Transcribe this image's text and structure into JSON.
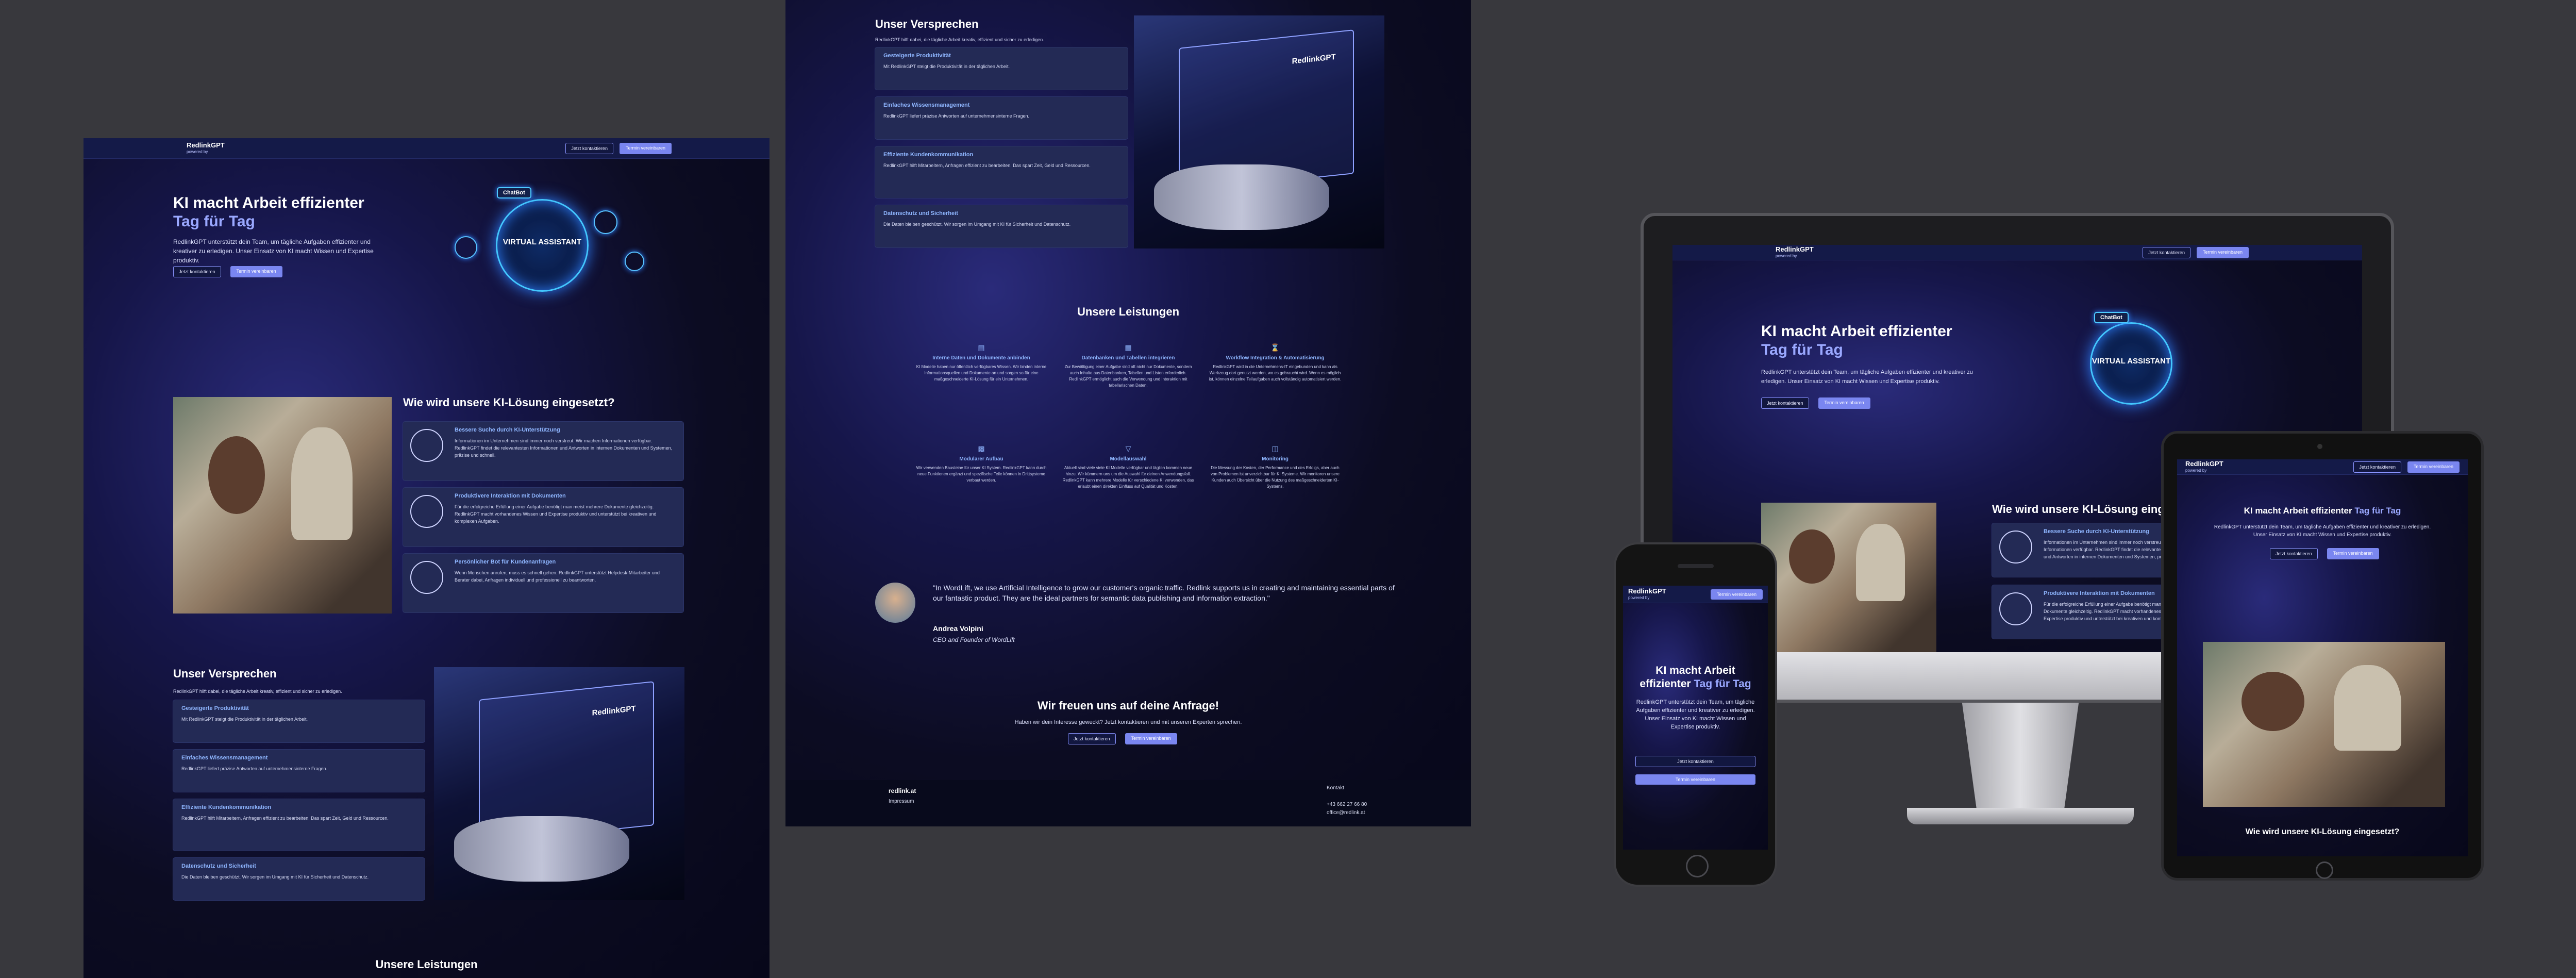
{
  "brand": {
    "name": "RedlinkGPT",
    "powered": "powered by"
  },
  "nav": {
    "contact": "Jetzt kontaktieren",
    "book": "Termin vereinbaren"
  },
  "hero": {
    "title_line1": "KI macht Arbeit effizienter",
    "title_accent": "Tag für Tag",
    "text": "RedlinkGPT unterstützt dein Team, um tägliche Aufgaben effizienter und kreativer zu erledigen. Unser Einsatz von KI macht Wissen und Expertise produktiv.",
    "btn_contact": "Jetzt kontaktieren",
    "btn_book": "Termin vereinbaren",
    "chatbot": "ChatBot",
    "assistant": "VIRTUAL ASSISTANT"
  },
  "usage": {
    "title": "Wie wird unsere KI-Lösung eingesetzt?",
    "items": [
      {
        "title": "Bessere Suche durch KI-Unterstützung",
        "text": "Informationen im Unternehmen sind immer noch verstreut. Wir machen Informationen verfügbar. RedlinkGPT findet die relevantesten Informationen und Antworten in internen Dokumenten und Systemen, präzise und schnell."
      },
      {
        "title": "Produktivere Interaktion mit Dokumenten",
        "text": "Für die erfolgreiche Erfüllung einer Aufgabe benötigt man meist mehrere Dokumente gleichzeitig. RedlinkGPT macht vorhandenes Wissen und Expertise produktiv und unterstützt bei kreativen und komplexen Aufgaben."
      },
      {
        "title": "Persönlicher Bot für Kundenanfragen",
        "text": "Wenn Menschen anrufen, muss es schnell gehen. RedlinkGPT unterstützt Helpdesk-Mitarbeiter und Berater dabei, Anfragen individuell und professionell zu beantworten."
      }
    ]
  },
  "promise": {
    "title": "Unser Versprechen",
    "subtitle": "RedlinkGPT hilft dabei, die tägliche Arbeit kreativ, effizient und sicher zu erledigen.",
    "items": [
      {
        "title": "Gesteigerte Produktivität",
        "text": "Mit RedlinkGPT steigt die Produktivität in der täglichen Arbeit."
      },
      {
        "title": "Einfaches Wissensmanagement",
        "text": "RedlinkGPT liefert präzise Antworten auf unternehmensinterne Fragen."
      },
      {
        "title": "Effiziente Kundenkommunikation",
        "text": "RedlinkGPT hilft Mitarbeitern, Anfragen effizient zu bearbeiten. Das spart Zeit, Geld und Ressourcen."
      },
      {
        "title": "Datenschutz und Sicherheit",
        "text": "Die Daten bleiben geschützt. Wir sorgen im Umgang mit KI für Sicherheit und Datenschutz."
      }
    ]
  },
  "services": {
    "title": "Unsere Leistungen",
    "items": [
      {
        "icon": "document-icon",
        "title": "Interne Daten und Dokumente anbinden",
        "text": "KI Modelle haben nur öffentlich verfügbares Wissen. Wir binden interne Informationsquellen und Dokumente an und sorgen so für eine maßgeschneiderte KI-Lösung für ein Unternehmen."
      },
      {
        "icon": "database-icon",
        "title": "Datenbanken und Tabellen integrieren",
        "text": "Zur Bewältigung einer Aufgabe sind oft nicht nur Dokumente, sondern auch Inhalte aus Datenbanken, Tabellen und Listen erforderlich. RedlinkGPT ermöglicht auch die Verwendung und Interaktion mit tabellarischen Daten."
      },
      {
        "icon": "workflow-icon",
        "title": "Workflow Integration & Automatisierung",
        "text": "RedlinkGPT wird in die Unternehmens-IT eingebunden und kann als Werkzeug dort genutzt werden, wo es gebraucht wird. Wenn es möglich ist, können einzelne Teilaufgaben auch vollständig automatisiert werden."
      },
      {
        "icon": "modules-icon",
        "title": "Modularer Aufbau",
        "text": "Wir verwenden Bausteine für unser KI System. RedlinkGPT kann durch neue Funktionen ergänzt und spezifische Teile können in Drittsysteme verbaut werden."
      },
      {
        "icon": "model-icon",
        "title": "Modellauswahl",
        "text": "Aktuell sind viele viele KI Modelle verfügbar und täglich kommen neue hinzu. Wir kümmern uns um die Auswahl für deinen Anwendungsfall. RedlinkGPT kann mehrere Modelle für verschiedene KI verwenden, das erlaubt einen direkten Einfluss auf Qualität und Kosten."
      },
      {
        "icon": "monitoring-icon",
        "title": "Monitoring",
        "text": "Die Messung der Kosten, der Performance und des Erfolgs, aber auch von Problemen ist unverzichtbar für KI Systeme. Wir monitoren unsere Kunden auch Übersicht über die Nutzung des maßgeschneiderten KI-Systems."
      }
    ]
  },
  "testimonial": {
    "quote": "\"In WordLift, we use Artificial Intelligence to grow our customer's organic traffic. Redlink supports us in creating and maintaining essential parts of our fantastic product. They are the ideal partners for semantic data publishing and information extraction.\"",
    "name": "Andrea Volpini",
    "role": "CEO and Founder of WordLift"
  },
  "cta": {
    "title": "Wir freuen uns auf deine Anfrage!",
    "text": "Haben wir dein Interesse geweckt? Jetzt kontaktieren und mit unseren Experten sprechen.",
    "btn_contact": "Jetzt kontaktieren",
    "btn_book": "Termin vereinbaren"
  },
  "footer": {
    "site": "redlink.at",
    "imprint": "Impressum",
    "contact_label": "Kontakt",
    "phone": "+43 662 27 66 80",
    "email": "office@redlink.at"
  },
  "phone_hero": {
    "title_a": "KI macht Arbeit",
    "title_b": "effizienter",
    "title_accent": "Tag für Tag"
  },
  "colors": {
    "accent": "#9aa8ff",
    "button": "#7a86f0",
    "card": "#232a55",
    "background": "#38383d"
  }
}
